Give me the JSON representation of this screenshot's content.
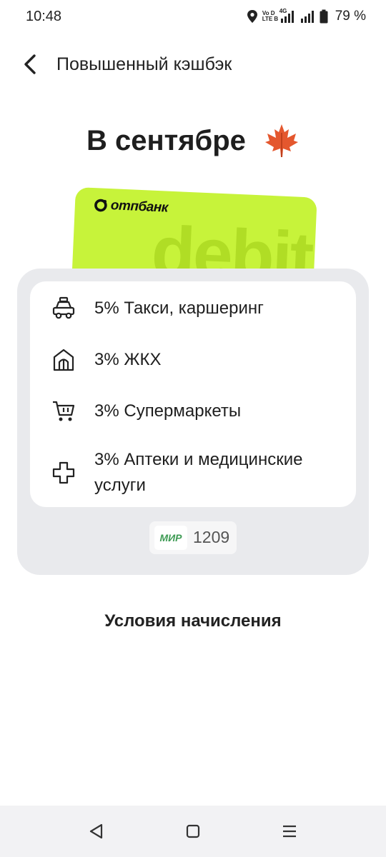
{
  "status_bar": {
    "time": "10:48",
    "net_top": "Vo D",
    "net_bottom": "LTE B",
    "net_gen": "4G",
    "battery": "79 %"
  },
  "header": {
    "title": "Повышенный кэшбэк"
  },
  "month": {
    "title": "В сентябре",
    "icon": "maple-leaf-icon"
  },
  "card": {
    "brand": "отпбанк",
    "product": "debit",
    "color": "#c7f33a"
  },
  "cashback": {
    "items": [
      {
        "label": "5% Такси, каршеринг",
        "icon": "taxi-icon"
      },
      {
        "label": "3% ЖКХ",
        "icon": "house-icon"
      },
      {
        "label": "3% Супермаркеты",
        "icon": "cart-icon"
      },
      {
        "label": "3% Аптеки и медицинские услуги",
        "icon": "medical-cross-icon"
      }
    ]
  },
  "payment_card": {
    "system": "МИР",
    "last_digits": "1209"
  },
  "conditions_link": "Условия начисления",
  "nav": {
    "back_icon": "triangle-back-icon",
    "home_icon": "square-home-icon",
    "menu_icon": "menu-lines-icon"
  }
}
